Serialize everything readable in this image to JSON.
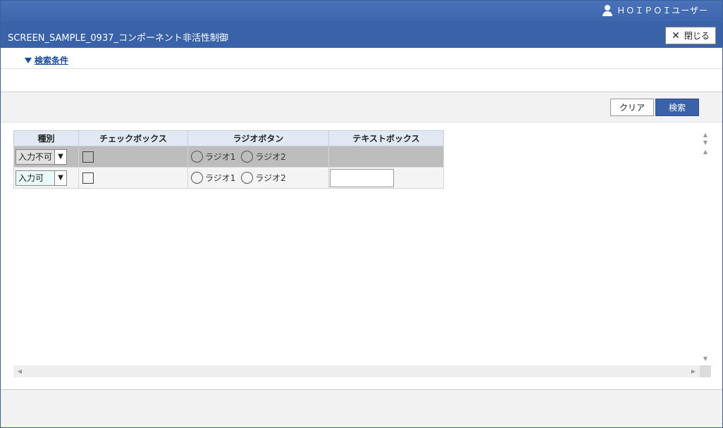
{
  "header": {
    "user_name": "ＨＯＩＰＯＩユーザー"
  },
  "titlebar": {
    "title": "SCREEN_SAMPLE_0937_コンポーネント非活性制御",
    "close_label": "閉じる"
  },
  "search_conditions": {
    "toggle_label": "検索条件"
  },
  "actions": {
    "clear_label": "クリア",
    "search_label": "検索"
  },
  "grid": {
    "columns": [
      "種別",
      "チェックボックス",
      "ラジオボタン",
      "テキストボックス"
    ],
    "rows": [
      {
        "type": "入力不可",
        "radio1": "ラジオ1",
        "radio2": "ラジオ2",
        "text": ""
      },
      {
        "type": "入力可",
        "radio1": "ラジオ1",
        "radio2": "ラジオ2",
        "text": ""
      }
    ]
  }
}
